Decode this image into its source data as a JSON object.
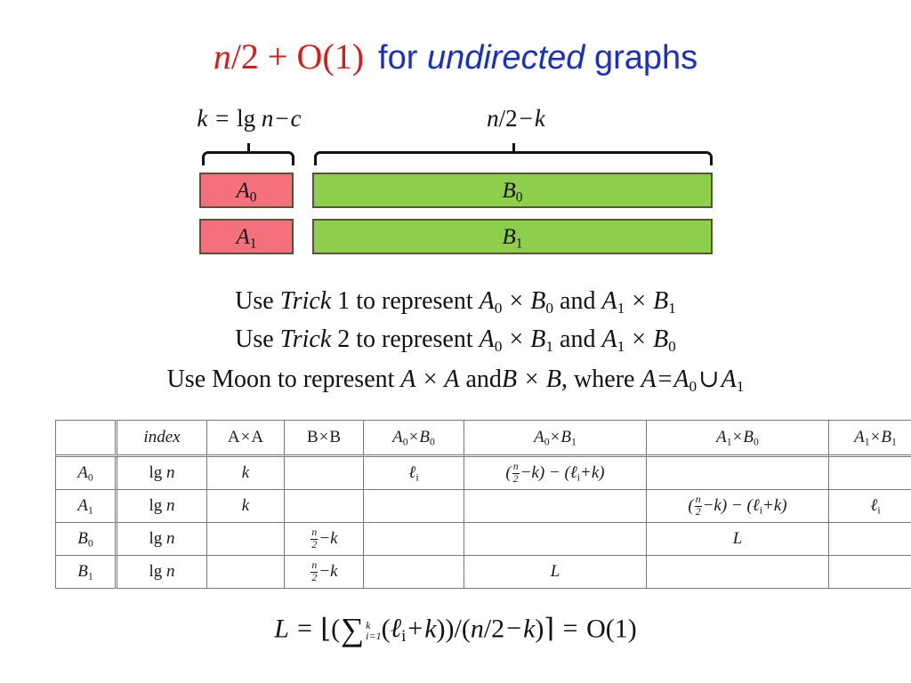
{
  "title": {
    "red_part": "n/2 + O(1)",
    "red_n": "n",
    "red_rest": "/2 + O(1)",
    "blue_for": "for",
    "blue_undirected": "undirected",
    "blue_graphs": "graphs"
  },
  "brace_labels": {
    "left": "k  =  lg n − c",
    "left_var": "k",
    "left_eq": "=",
    "left_lg": "lg",
    "left_n": "n",
    "left_minus": "−",
    "left_c": "c",
    "right": "n/2 − k",
    "right_n": "n",
    "right_slash2": "/2",
    "right_minus": "−",
    "right_k": "k"
  },
  "bars": [
    {
      "name": "A0",
      "label_base": "A",
      "label_sub": "0",
      "color": "#F4707C",
      "group": "A"
    },
    {
      "name": "A1",
      "label_base": "A",
      "label_sub": "1",
      "color": "#F4707C",
      "group": "A"
    },
    {
      "name": "B0",
      "label_base": "B",
      "label_sub": "0",
      "color": "#8DCE4A",
      "group": "B"
    },
    {
      "name": "B1",
      "label_base": "B",
      "label_sub": "1",
      "color": "#8DCE4A",
      "group": "B"
    }
  ],
  "sentences": {
    "line1": {
      "use": "Use",
      "trick": "Trick",
      "num": "1",
      "to_represent": "to represent",
      "term1_a": "A",
      "term1_a_sub": "0",
      "term1_b": "B",
      "term1_b_sub": "0",
      "and": "and",
      "term2_a": "A",
      "term2_a_sub": "1",
      "term2_b": "B",
      "term2_b_sub": "1",
      "plain": "Use Trick 1 to represent A0 × B0 and A1 × B1"
    },
    "line2": {
      "use": "Use",
      "trick": "Trick",
      "num": "2",
      "to_represent": "to represent",
      "term1_a": "A",
      "term1_a_sub": "0",
      "term1_b": "B",
      "term1_b_sub": "1",
      "and": "and",
      "term2_a": "A",
      "term2_a_sub": "1",
      "term2_b": "B",
      "term2_b_sub": "0",
      "plain": "Use Trick 2 to represent A0 × B1 and A1 × B0"
    },
    "line3": {
      "use_moon": "Use Moon to represent",
      "term1": "A × A",
      "and": "and",
      "term2": "B × B",
      "where": ", where",
      "eq_a": "A",
      "eq": "=",
      "eq_a0": "A",
      "eq_a0_sub": "0",
      "cup": "∪",
      "eq_a1": "A",
      "eq_a1_sub": "1",
      "plain": "Use Moon to represent A × A and B × B, where A = A0 ∪ A1"
    }
  },
  "table": {
    "headers": [
      {
        "id": "rowhead",
        "text": ""
      },
      {
        "id": "index",
        "text": "index"
      },
      {
        "id": "AxA",
        "text": "A×A"
      },
      {
        "id": "BxB",
        "text": "B×B"
      },
      {
        "id": "A0xB0",
        "text": "A₀×B₀"
      },
      {
        "id": "A0xB1",
        "text": "A₀×B₁"
      },
      {
        "id": "A1xB0",
        "text": "A₁×B₀"
      },
      {
        "id": "A1xB1",
        "text": "A₁×B₁"
      }
    ],
    "rows": [
      {
        "label": "A₀",
        "index": "lg n",
        "AxA": "k",
        "BxB": "",
        "A0xB0": "ℓᵢ",
        "A0xB1": "(n/2−k) − (ℓᵢ+k)",
        "A1xB0": "",
        "A1xB1": ""
      },
      {
        "label": "A₁",
        "index": "lg n",
        "AxA": "k",
        "BxB": "",
        "A0xB0": "",
        "A0xB1": "",
        "A1xB0": "(n/2−k) − (ℓᵢ+k)",
        "A1xB1": "ℓᵢ"
      },
      {
        "label": "B₀",
        "index": "lg n",
        "AxA": "",
        "BxB": "n/2−k",
        "A0xB0": "",
        "A0xB1": "",
        "A1xB0": "L",
        "A1xB1": ""
      },
      {
        "label": "B₁",
        "index": "lg n",
        "AxA": "",
        "BxB": "n/2−k",
        "A0xB0": "",
        "A0xB1": "L",
        "A1xB0": "",
        "A1xB1": ""
      }
    ]
  },
  "formula": {
    "lhs": "L",
    "eq1": "=",
    "body": "⌈(∑ᵢ₌₁ᵏ(ℓᵢ + k))/(n/2 − k)⌉",
    "eq2": "=",
    "rhs": "O(1)",
    "sum_upper": "k",
    "sum_lower": "i=1",
    "plain": "L = ⌈(∑_{i=1}^{k}(ℓ_i + k))/(n/2 − k)⌉ = O(1)"
  },
  "colors": {
    "title_red": "#DD1A17",
    "title_blue": "#1A2FC4",
    "bar_red": "#F4707C",
    "bar_green": "#8DCE4A",
    "rule": "#777777",
    "text": "#111111"
  }
}
